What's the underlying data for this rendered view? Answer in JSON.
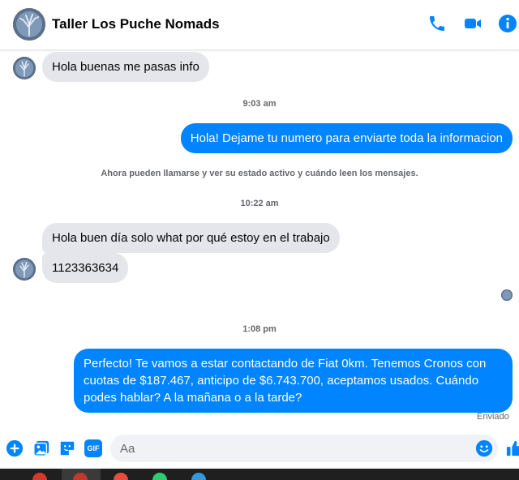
{
  "header": {
    "title": "Taller Los Puche Nomads",
    "icons": [
      "phone-icon",
      "video-camera-icon",
      "info-icon"
    ],
    "accent": "#0084ff"
  },
  "messages": {
    "m1": "Hola buenas me pasas info",
    "t1": "9:03 am",
    "m2": "Hola! Dejame tu numero para enviarte toda la informacion",
    "notice": "Ahora pueden llamarse y ver su estado activo y cuándo leen los mensajes.",
    "t2": "10:22 am",
    "m3": "Hola buen día solo what por qué estoy en el trabajo",
    "m4": "1123363634",
    "t3": "1:08 pm",
    "m5_lines": [
      "Perfecto! Te vamos a estar contactando de Fiat 0km. Tenemos Cronos con",
      "cuotas de $187.467, anticipo de $6.743.700, aceptamos usados. Cuándo",
      "podes hablar? A la mañana o a la tarde?"
    ],
    "status": "Enviado"
  },
  "composer": {
    "placeholder": "Aa",
    "icons": [
      "plus-icon",
      "image-icon",
      "sticker-icon",
      "gif-icon",
      "emoji-icon",
      "thumbs-up-icon"
    ],
    "gif_label": "GIF"
  },
  "colors": {
    "incoming_bubble": "#e4e6eb",
    "outgoing_bubble": "#0084ff"
  }
}
